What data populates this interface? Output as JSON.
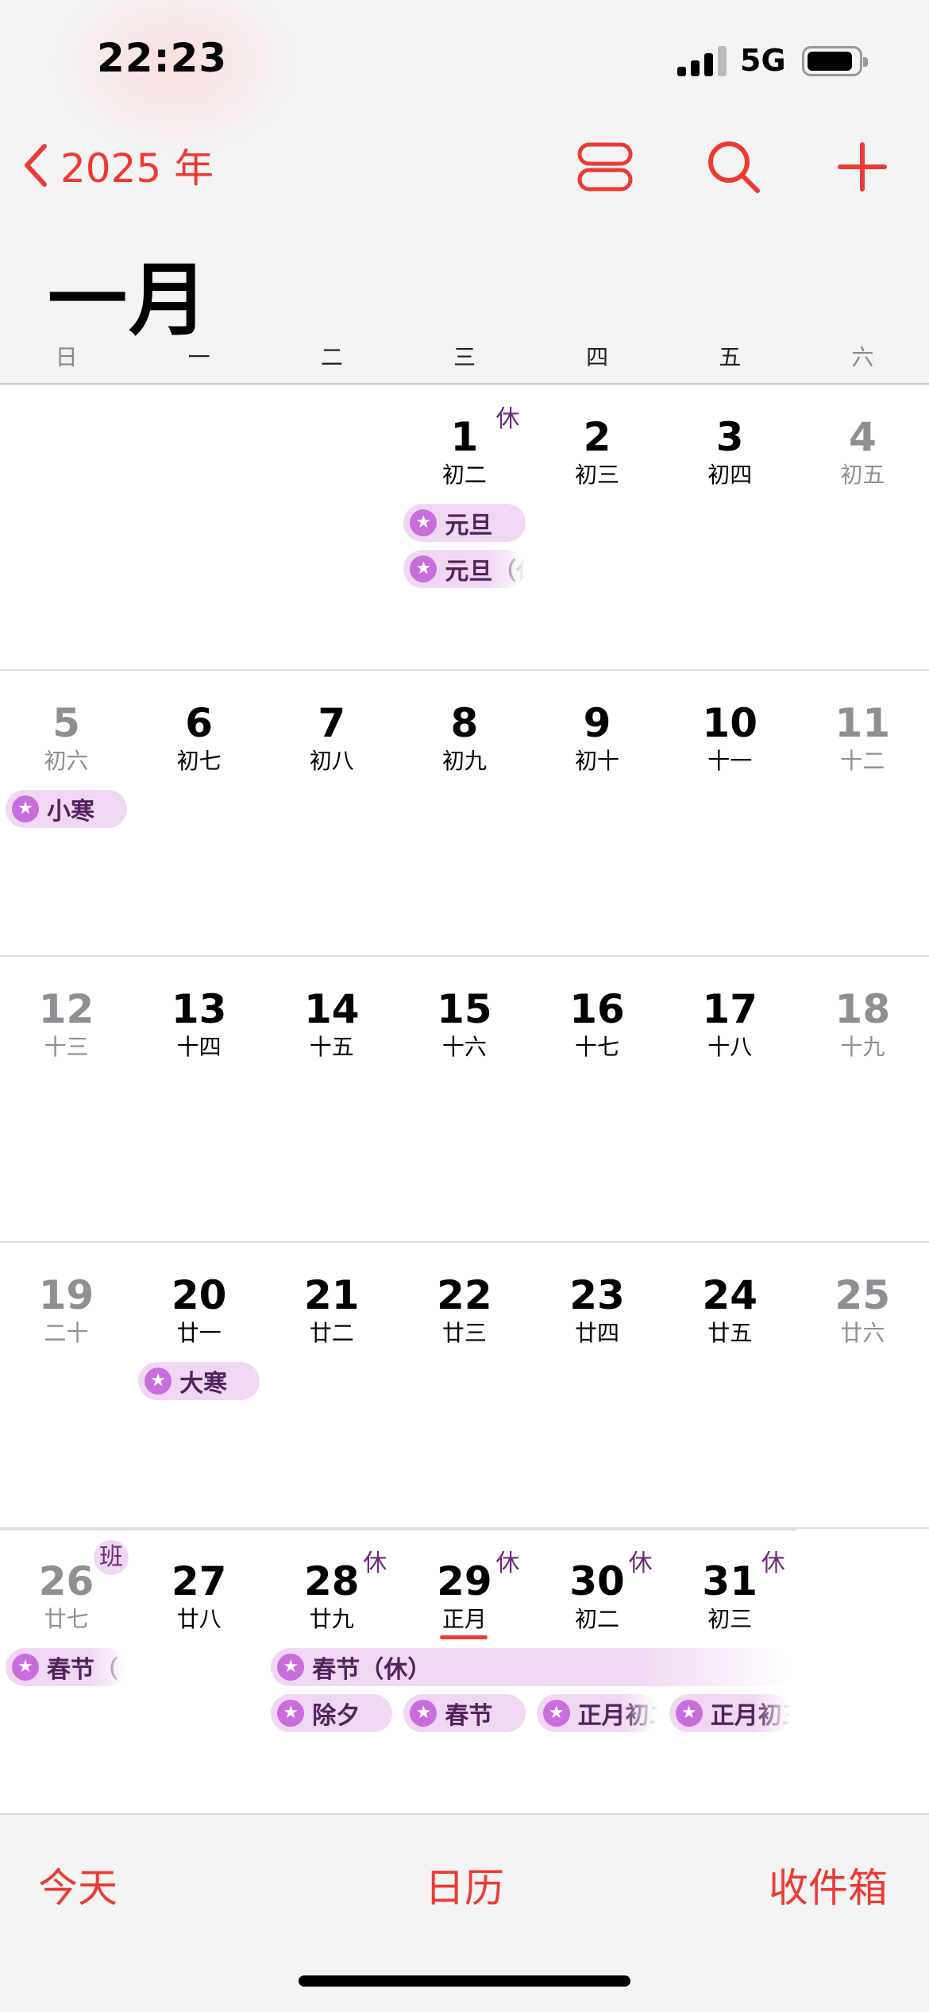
{
  "status": {
    "time": "22:23",
    "network": "5G"
  },
  "nav": {
    "back_label": "2025 年"
  },
  "month": {
    "title": "一月"
  },
  "weekdays": [
    "日",
    "一",
    "二",
    "三",
    "四",
    "五",
    "六"
  ],
  "colors": {
    "accent": "#ec3b34",
    "event_bg": "#f0d8f3",
    "event_icon": "#c86ddb",
    "event_text": "#52225c",
    "badge": "#6e2a7a"
  },
  "weeks": [
    {
      "days": [
        null,
        null,
        null,
        {
          "num": "1",
          "lunar": "初二",
          "badge": "休"
        },
        {
          "num": "2",
          "lunar": "初三"
        },
        {
          "num": "3",
          "lunar": "初四"
        },
        {
          "num": "4",
          "lunar": "初五",
          "dim": true
        }
      ],
      "events": [
        {
          "text": "元旦",
          "col": 3,
          "span": 1,
          "row": 0
        },
        {
          "text": "元旦（休）",
          "col": 3,
          "span": 1,
          "row": 1,
          "fade": true
        }
      ]
    },
    {
      "days": [
        {
          "num": "5",
          "lunar": "初六",
          "dim": true
        },
        {
          "num": "6",
          "lunar": "初七"
        },
        {
          "num": "7",
          "lunar": "初八"
        },
        {
          "num": "8",
          "lunar": "初九"
        },
        {
          "num": "9",
          "lunar": "初十"
        },
        {
          "num": "10",
          "lunar": "十一"
        },
        {
          "num": "11",
          "lunar": "十二",
          "dim": true
        }
      ],
      "events": [
        {
          "text": "小寒",
          "col": 0,
          "span": 1,
          "row": 0
        }
      ]
    },
    {
      "days": [
        {
          "num": "12",
          "lunar": "十三",
          "dim": true
        },
        {
          "num": "13",
          "lunar": "十四"
        },
        {
          "num": "14",
          "lunar": "十五"
        },
        {
          "num": "15",
          "lunar": "十六"
        },
        {
          "num": "16",
          "lunar": "十七"
        },
        {
          "num": "17",
          "lunar": "十八"
        },
        {
          "num": "18",
          "lunar": "十九",
          "dim": true
        }
      ],
      "events": []
    },
    {
      "days": [
        {
          "num": "19",
          "lunar": "二十",
          "dim": true
        },
        {
          "num": "20",
          "lunar": "廿一"
        },
        {
          "num": "21",
          "lunar": "廿二"
        },
        {
          "num": "22",
          "lunar": "廿三"
        },
        {
          "num": "23",
          "lunar": "廿四"
        },
        {
          "num": "24",
          "lunar": "廿五"
        },
        {
          "num": "25",
          "lunar": "廿六",
          "dim": true
        }
      ],
      "events": [
        {
          "text": "大寒",
          "col": 1,
          "span": 1,
          "row": 0
        }
      ]
    },
    {
      "days": [
        {
          "num": "26",
          "lunar": "廿七",
          "dim": true,
          "badge": "班"
        },
        {
          "num": "27",
          "lunar": "廿八"
        },
        {
          "num": "28",
          "lunar": "廿九",
          "badge": "休"
        },
        {
          "num": "29",
          "lunar": "正月",
          "badge": "休",
          "today": true
        },
        {
          "num": "30",
          "lunar": "初二",
          "badge": "休"
        },
        {
          "num": "31",
          "lunar": "初三",
          "badge": "休"
        },
        null
      ],
      "events": [
        {
          "text": "春节（",
          "col": 0,
          "span": 1,
          "row": 0,
          "fade": true
        },
        {
          "text": "春节（休）",
          "col": 2,
          "span": 4,
          "row": 0,
          "fade": true
        },
        {
          "text": "除夕",
          "col": 2,
          "span": 1,
          "row": 1
        },
        {
          "text": "春节",
          "col": 3,
          "span": 1,
          "row": 1
        },
        {
          "text": "正月初二",
          "col": 4,
          "span": 1,
          "row": 1,
          "fade": true
        },
        {
          "text": "正月初三",
          "col": 5,
          "span": 1,
          "row": 1,
          "fade": true
        }
      ]
    }
  ],
  "tabbar": {
    "today": "今天",
    "calendars": "日历",
    "inbox": "收件箱"
  }
}
